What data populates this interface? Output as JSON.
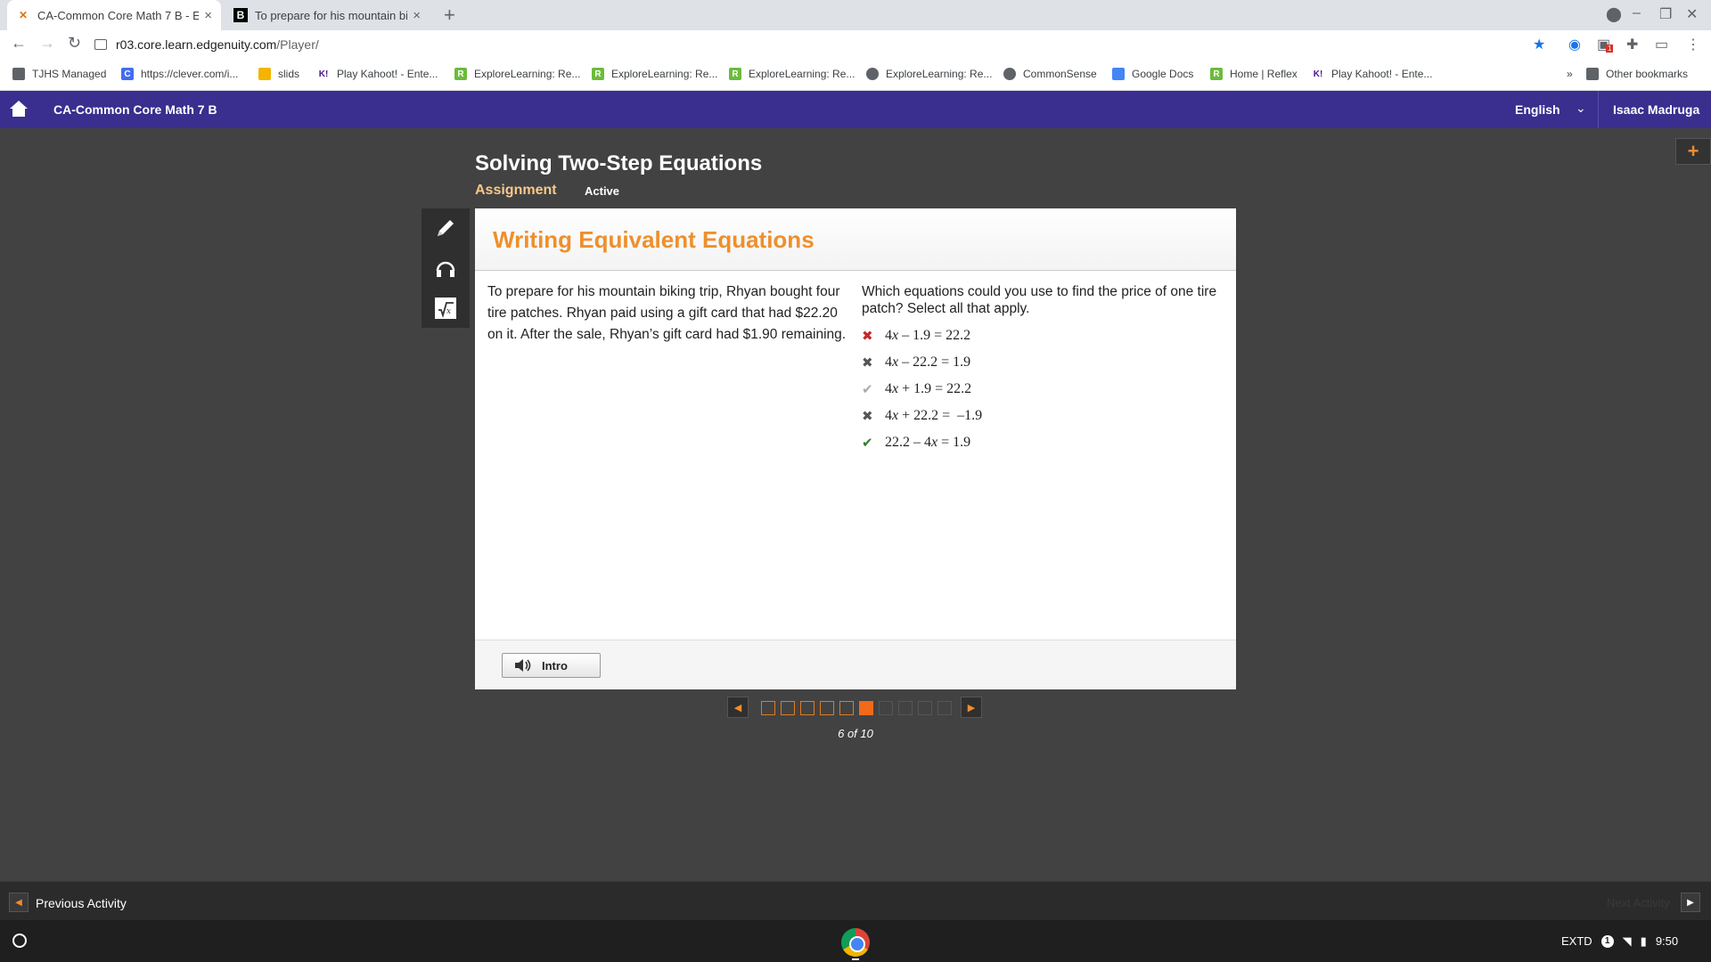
{
  "browser": {
    "tabs": [
      {
        "title": "CA-Common Core Math 7 B - Edg",
        "active": true
      },
      {
        "title": "To prepare for his mountain biki",
        "active": false
      }
    ],
    "url_host": "r03.core.learn.edgenuity.com",
    "url_path": "/Player/",
    "ext_badge": "1",
    "bookmarks": [
      {
        "label": "TJHS Managed",
        "icon": "folder-icon"
      },
      {
        "label": "https://clever.com/i...",
        "icon": "clever-icon"
      },
      {
        "label": "slids",
        "icon": "slides-icon"
      },
      {
        "label": "Play Kahoot! - Ente...",
        "icon": "kahoot-icon"
      },
      {
        "label": "ExploreLearning: Re...",
        "icon": "reflex-icon"
      },
      {
        "label": "ExploreLearning: Re...",
        "icon": "reflex-icon"
      },
      {
        "label": "ExploreLearning: Re...",
        "icon": "reflex-icon"
      },
      {
        "label": "ExploreLearning: Re...",
        "icon": "globe-icon"
      },
      {
        "label": "CommonSense",
        "icon": "globe-icon"
      },
      {
        "label": "Google Docs",
        "icon": "docs-icon"
      },
      {
        "label": "Home | Reflex",
        "icon": "reflex-icon"
      },
      {
        "label": "Play Kahoot! - Ente...",
        "icon": "kahoot-icon"
      }
    ],
    "other_bookmarks": "Other bookmarks",
    "overflow": "»"
  },
  "app": {
    "course": "CA-Common Core Math 7 B",
    "language": "English",
    "user": "Isaac Madruga",
    "plus": "+"
  },
  "lesson": {
    "title": "Solving Two-Step Equations",
    "type": "Assignment",
    "status": "Active"
  },
  "activity": {
    "title": "Writing Equivalent Equations",
    "problem": "To prepare for his mountain biking trip, Rhyan bought four tire patches. Rhyan paid using a gift card that had $22.20 on it. After the sale, Rhyan’s gift card had $1.90 remaining.",
    "question": "Which equations could you use to find the price of one tire patch? Select all that apply.",
    "options": [
      {
        "mark": "✖",
        "state": "incorrect-selected",
        "coef": "4",
        "var": "x",
        "rest": " – 1.9 = 22.2"
      },
      {
        "mark": "✖",
        "state": "incorrect",
        "coef": "4",
        "var": "x",
        "rest": " – 22.2 = 1.9"
      },
      {
        "mark": "✔",
        "state": "correct-unselected",
        "coef": "4",
        "var": "x",
        "rest": " + 1.9 = 22.2"
      },
      {
        "mark": "✖",
        "state": "incorrect",
        "coef": "4",
        "var": "x",
        "rest": " + 22.2 =  –1.9"
      },
      {
        "mark": "✔",
        "state": "correct-selected",
        "coef": "22.2 – 4",
        "var": "x",
        "rest": " = 1.9"
      }
    ],
    "intro_label": "Intro"
  },
  "pager": {
    "current": 6,
    "total": 10,
    "label": "6 of 10"
  },
  "footer": {
    "previous": "Previous Activity",
    "next": "Next Activity"
  },
  "os": {
    "tray_label": "EXTD",
    "notifications": "1",
    "time": "9:50"
  },
  "colors": {
    "app_header": "#3a2e8f",
    "accent_orange": "#ef8f2c",
    "correct": "#2e7d32",
    "incorrect": "#c62828"
  }
}
